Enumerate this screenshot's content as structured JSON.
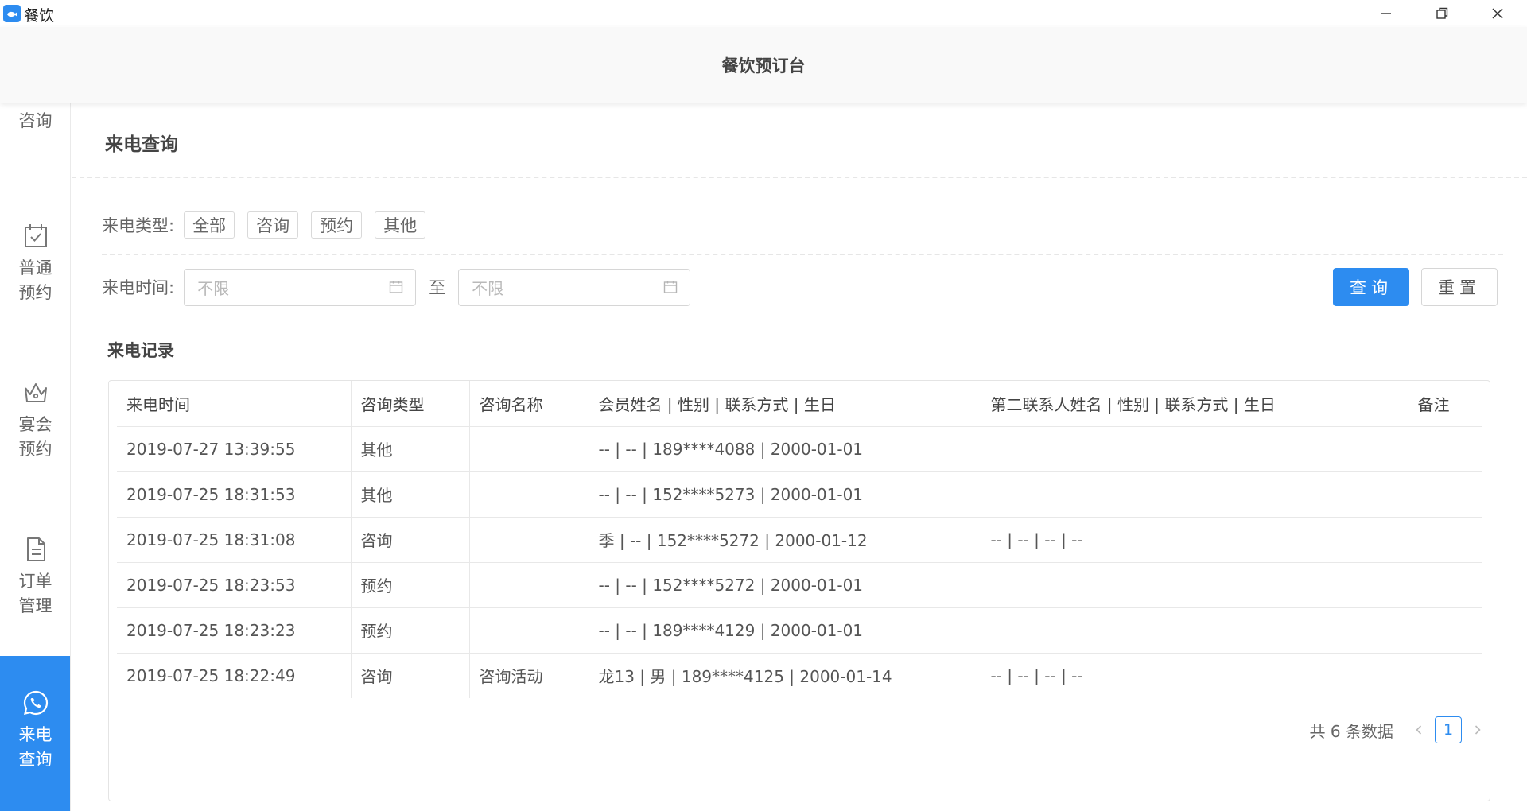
{
  "window": {
    "app_title": "餐饮",
    "logo_icon": "fish-logo-icon",
    "controls": [
      "minimize-icon",
      "restore-icon",
      "close-icon"
    ]
  },
  "header": {
    "title": "餐饮预订台"
  },
  "sidebar": {
    "items": [
      {
        "label": "咨询",
        "icon": "chat-icon",
        "active": false
      },
      {
        "label": "普通预约",
        "icon": "calendar-check-icon",
        "active": false
      },
      {
        "label": "宴会预约",
        "icon": "crown-icon",
        "active": false
      },
      {
        "label": "订单管理",
        "icon": "document-icon",
        "active": false
      },
      {
        "label": "来电查询",
        "icon": "phone-call-icon",
        "active": true
      }
    ]
  },
  "page": {
    "title": "来电查询"
  },
  "filters": {
    "type_label": "来电类型:",
    "types": [
      "全部",
      "咨询",
      "预约",
      "其他"
    ],
    "time_label": "来电时间:",
    "start_placeholder": "不限",
    "to_label": "至",
    "end_placeholder": "不限",
    "query_label": "查询",
    "reset_label": "重置"
  },
  "records": {
    "title": "来电记录",
    "columns": [
      "来电时间",
      "咨询类型",
      "咨询名称",
      "会员姓名 | 性别 | 联系方式 | 生日",
      "第二联系人姓名 | 性别 | 联系方式 | 生日",
      "备注"
    ],
    "rows": [
      [
        "2019-07-27 13:39:55",
        "其他",
        "",
        "-- | -- | 189****4088 | 2000-01-01",
        "",
        ""
      ],
      [
        "2019-07-25 18:31:53",
        "其他",
        "",
        "-- | -- | 152****5273 | 2000-01-01",
        "",
        ""
      ],
      [
        "2019-07-25 18:31:08",
        "咨询",
        "",
        "季 | -- | 152****5272 | 2000-01-12",
        "-- | -- | -- | --",
        ""
      ],
      [
        "2019-07-25 18:23:53",
        "预约",
        "",
        "-- | -- | 152****5272 | 2000-01-01",
        "",
        ""
      ],
      [
        "2019-07-25 18:23:23",
        "预约",
        "",
        "-- | -- | 189****4129 | 2000-01-01",
        "",
        ""
      ],
      [
        "2019-07-25 18:22:49",
        "咨询",
        "咨询活动",
        "龙13 | 男 | 189****4125 | 2000-01-14",
        "-- | -- | -- | --",
        ""
      ]
    ]
  },
  "pagination": {
    "total_text": "共 6 条数据",
    "current_page": "1"
  },
  "colors": {
    "accent": "#2d8cf0"
  }
}
